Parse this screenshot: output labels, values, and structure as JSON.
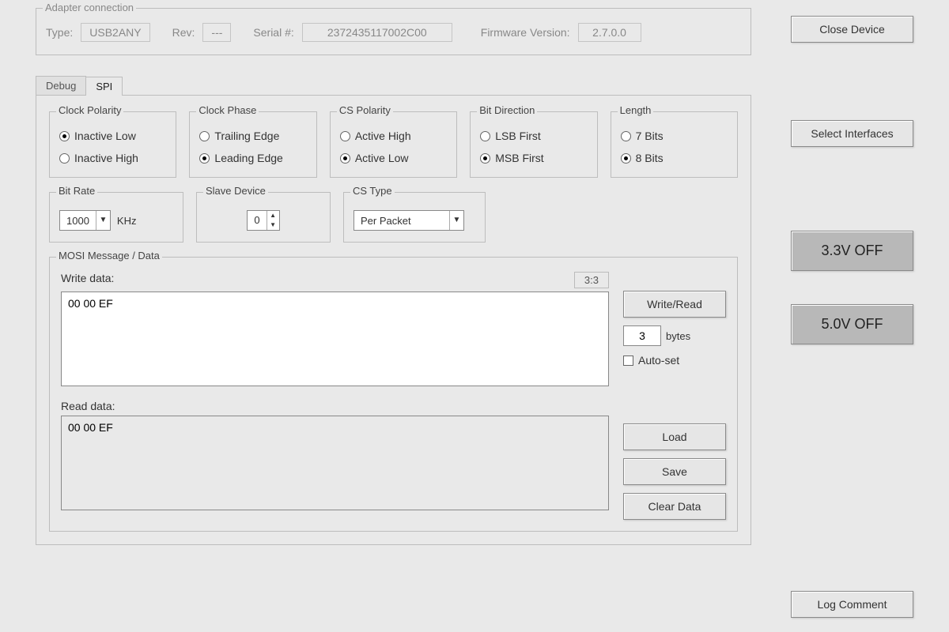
{
  "adapter": {
    "group_label": "Adapter connection",
    "type_label": "Type:",
    "type_value": "USB2ANY",
    "rev_label": "Rev:",
    "rev_value": "---",
    "serial_label": "Serial #:",
    "serial_value": "2372435117002C00",
    "fw_label": "Firmware Version:",
    "fw_value": "2.7.0.0"
  },
  "sidebar": {
    "close_device": "Close Device",
    "select_interfaces": "Select Interfaces",
    "volt33": "3.3V OFF",
    "volt50": "5.0V OFF",
    "log_comment": "Log Comment"
  },
  "tabs": {
    "debug": "Debug",
    "spi": "SPI"
  },
  "spi": {
    "clock_polarity": {
      "title": "Clock Polarity",
      "opt1": "Inactive Low",
      "opt2": "Inactive High",
      "selected": 0
    },
    "clock_phase": {
      "title": "Clock Phase",
      "opt1": "Trailing Edge",
      "opt2": "Leading Edge",
      "selected": 1
    },
    "cs_polarity": {
      "title": "CS Polarity",
      "opt1": "Active High",
      "opt2": "Active Low",
      "selected": 1
    },
    "bit_direction": {
      "title": "Bit Direction",
      "opt1": "LSB First",
      "opt2": "MSB First",
      "selected": 1
    },
    "length": {
      "title": "Length",
      "opt1": "7 Bits",
      "opt2": "8 Bits",
      "selected": 1
    },
    "bit_rate": {
      "title": "Bit Rate",
      "value": "1000",
      "unit": "KHz"
    },
    "slave_dev": {
      "title": "Slave Device",
      "value": "0"
    },
    "cs_type": {
      "title": "CS Type",
      "value": "Per Packet"
    }
  },
  "mosi": {
    "title": "MOSI Message / Data",
    "write_label": "Write data:",
    "write_value": "00 00 EF",
    "counter": "3:3",
    "read_label": "Read data:",
    "read_value": "00 00 EF",
    "write_read_btn": "Write/Read",
    "bytes_value": "3",
    "bytes_label": "bytes",
    "auto_set": "Auto-set",
    "load_btn": "Load",
    "save_btn": "Save",
    "clear_btn": "Clear Data"
  }
}
